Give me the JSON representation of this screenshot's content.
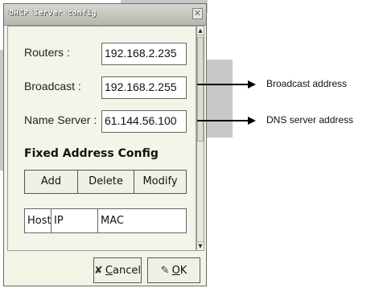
{
  "dialog": {
    "title": "DHCP Server config",
    "close_symbol": "✕"
  },
  "fields": {
    "routers_label": "Routers :",
    "routers_value": "192.168.2.235",
    "broadcast_label": "Broadcast :",
    "broadcast_value": "192.168.2.255",
    "nameserver_label": "Name Server :",
    "nameserver_value": "61.144.56.100"
  },
  "fixed_address": {
    "title": "Fixed Address Config",
    "buttons": [
      "Add",
      "Delete",
      "Modify"
    ],
    "table_headers": [
      "Host",
      "IP",
      "MAC"
    ]
  },
  "footer": {
    "cancel_prefix": "",
    "cancel_mnemonic": "C",
    "cancel_rest": "ancel",
    "ok_mnemonic": "O",
    "ok_rest": "K"
  },
  "annotations": {
    "broadcast": "Broadcast address",
    "dns": "DNS server address"
  },
  "icons": {
    "cancel": "cancel-icon",
    "ok": "ok-icon",
    "scroll_up": "scroll-up-icon",
    "scroll_down": "scroll-down-icon"
  }
}
